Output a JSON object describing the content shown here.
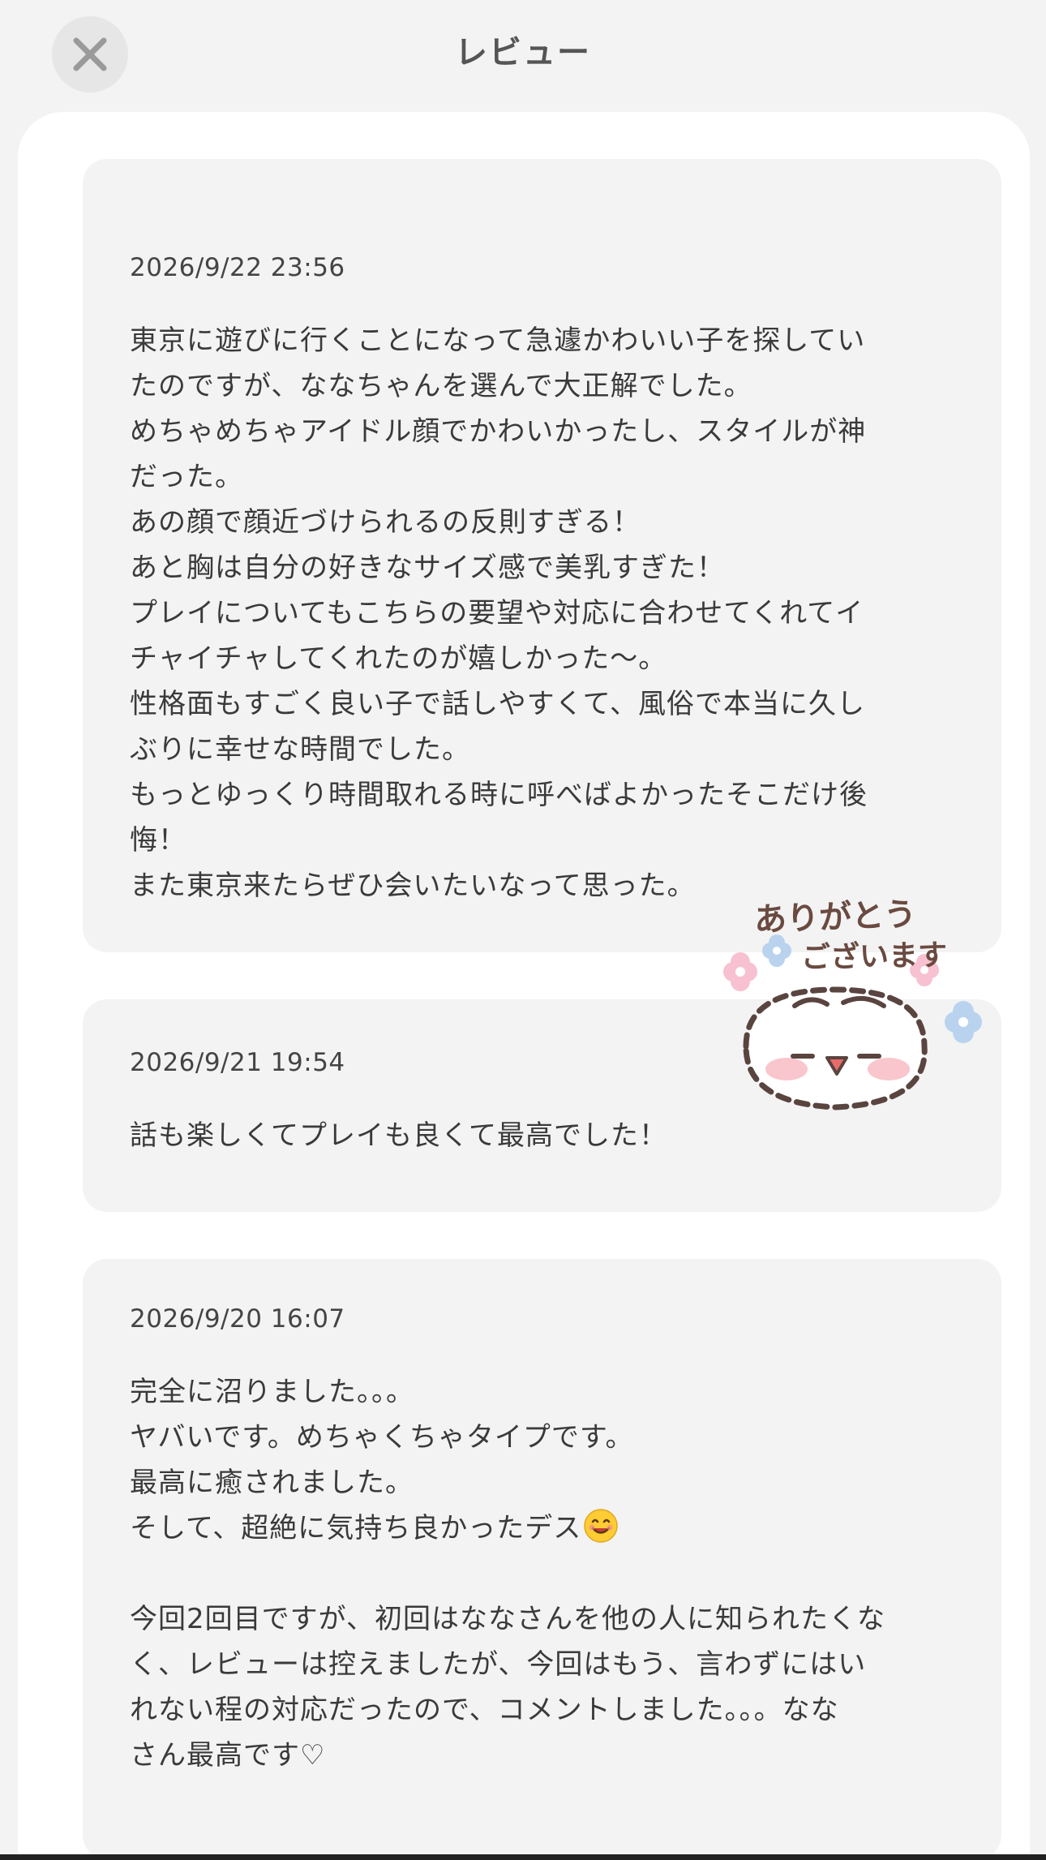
{
  "header": {
    "title": "レビュー"
  },
  "reviews": [
    {
      "date": "2026/9/22 23:56",
      "lines": [
        "東京に遊びに行くことになって急遽かわいい子を探してい",
        "たのですが、ななちゃんを選んで大正解でした。",
        "めちゃめちゃアイドル顔でかわいかったし、スタイルが神",
        "だった。",
        "あの顔で顔近づけられるの反則すぎる！",
        "あと胸は自分の好きなサイズ感で美乳すぎた！",
        "プレイについてもこちらの要望や対応に合わせてくれてイ",
        "チャイチャしてくれたのが嬉しかった〜。",
        "性格面もすごく良い子で話しやすくて、風俗で本当に久し",
        "ぶりに幸せな時間でした。",
        "もっとゆっくり時間取れる時に呼べばよかったそこだけ後",
        "悔！",
        "また東京来たらぜひ会いたいなって思った。"
      ]
    },
    {
      "date": "2026/9/21 19:54",
      "lines": [
        "話も楽しくてプレイも良くて最高でした！"
      ]
    },
    {
      "date": "2026/9/20 16:07",
      "lines": [
        "完全に沼りました。。。",
        "ヤバいです。めちゃくちゃタイプです。",
        "最高に癒されました。",
        "そして、超絶に気持ち良かったデス",
        "",
        "今回2回目ですが、初回はななさんを他の人に知られたくな",
        "く、レビューは控えましたが、今回はもう、言わずにはい",
        "れない程の対応だったので、コメントしました。。。なな",
        "さん最高です♡"
      ],
      "emoji": "smiling-face-emoji"
    }
  ],
  "sticker": {
    "line1": "ありがとう",
    "line2": "ございます",
    "icon": "hamster-thank-you-sticker"
  },
  "colors": {
    "background": "#f3f3f3",
    "sheet": "#ffffff",
    "card": "#f3f3f3",
    "text": "#3a3a3a",
    "sticker_text": "#6a4a40"
  }
}
